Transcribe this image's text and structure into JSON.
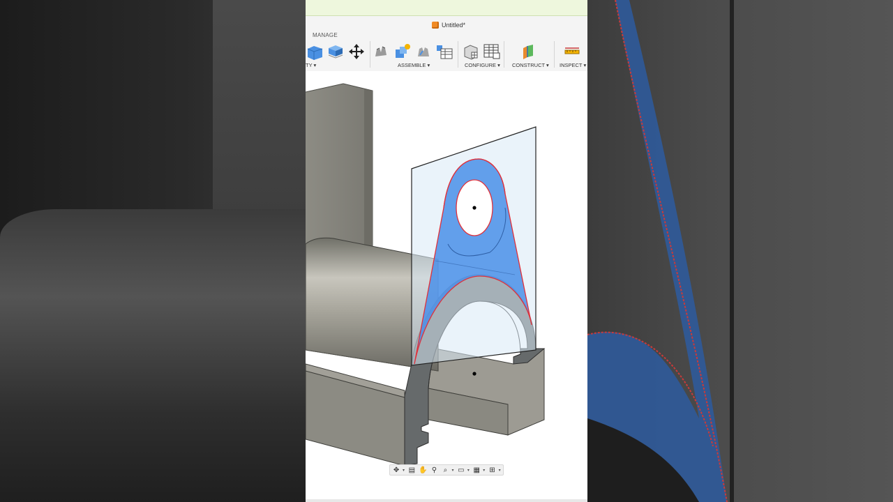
{
  "window": {
    "title": "Untitled*"
  },
  "toolbar": {
    "active_tab": "MANAGE",
    "groups": [
      {
        "label": "TY",
        "caret": "▾"
      },
      {
        "label": "ASSEMBLE",
        "caret": "▾"
      },
      {
        "label": "CONFIGURE",
        "caret": "▾"
      },
      {
        "label": "CONSTRUCT",
        "caret": "▾"
      },
      {
        "label": "INSPECT",
        "caret": "▾"
      }
    ]
  },
  "icons": {
    "doc": "fusion-cube-icon",
    "tools": [
      "box-stack-icon",
      "offset-face-icon",
      "move-icon",
      "new-component-icon",
      "joint-icon",
      "as-built-joint-icon",
      "joint-table-icon",
      "configure-icon",
      "configure-table-icon",
      "plane-icon",
      "measure-icon"
    ],
    "nav": [
      "orbit-icon",
      "look-at-icon",
      "pan-icon",
      "zoom-icon",
      "fit-icon",
      "display-settings-icon",
      "grid-icon",
      "viewports-icon"
    ]
  },
  "colors": {
    "accent_blue": "#5b9bf0",
    "selection_red": "#e0303a",
    "top_bar": "#eef7dd",
    "model_gray": "#8a8a85"
  }
}
